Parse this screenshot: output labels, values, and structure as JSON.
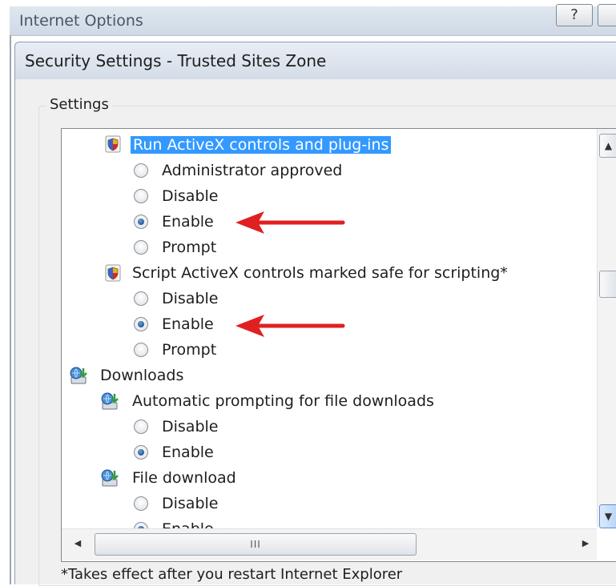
{
  "outer_window": {
    "title": "Internet Options",
    "help_label": "?"
  },
  "dialog": {
    "title": "Security Settings - Trusted Sites Zone",
    "group_label": "Settings",
    "footnote": "*Takes effect after you restart Internet Explorer"
  },
  "settings": {
    "run_activex": {
      "label": "Run ActiveX controls and plug-ins",
      "options": [
        "Administrator approved",
        "Disable",
        "Enable",
        "Prompt"
      ],
      "selected": "Enable"
    },
    "script_activex": {
      "label": "Script ActiveX controls marked safe for scripting*",
      "options": [
        "Disable",
        "Enable",
        "Prompt"
      ],
      "selected": "Enable"
    },
    "downloads": {
      "label": "Downloads",
      "automatic_prompting": {
        "label": "Automatic prompting for file downloads",
        "options": [
          "Disable",
          "Enable"
        ],
        "selected": "Enable"
      },
      "file_download": {
        "label": "File download",
        "options": [
          "Disable",
          "Enable"
        ],
        "selected": "Enable"
      }
    }
  },
  "scrollbar": {
    "up_glyph": "▲",
    "down_glyph": "▼",
    "left_glyph": "◀",
    "right_glyph": "▶",
    "thumb_grip": "III"
  },
  "colors": {
    "selection": "#3399ff",
    "annotation_arrow": "#e02020"
  },
  "icons": {
    "activex": "shield-icon",
    "downloads": "download-icon"
  }
}
